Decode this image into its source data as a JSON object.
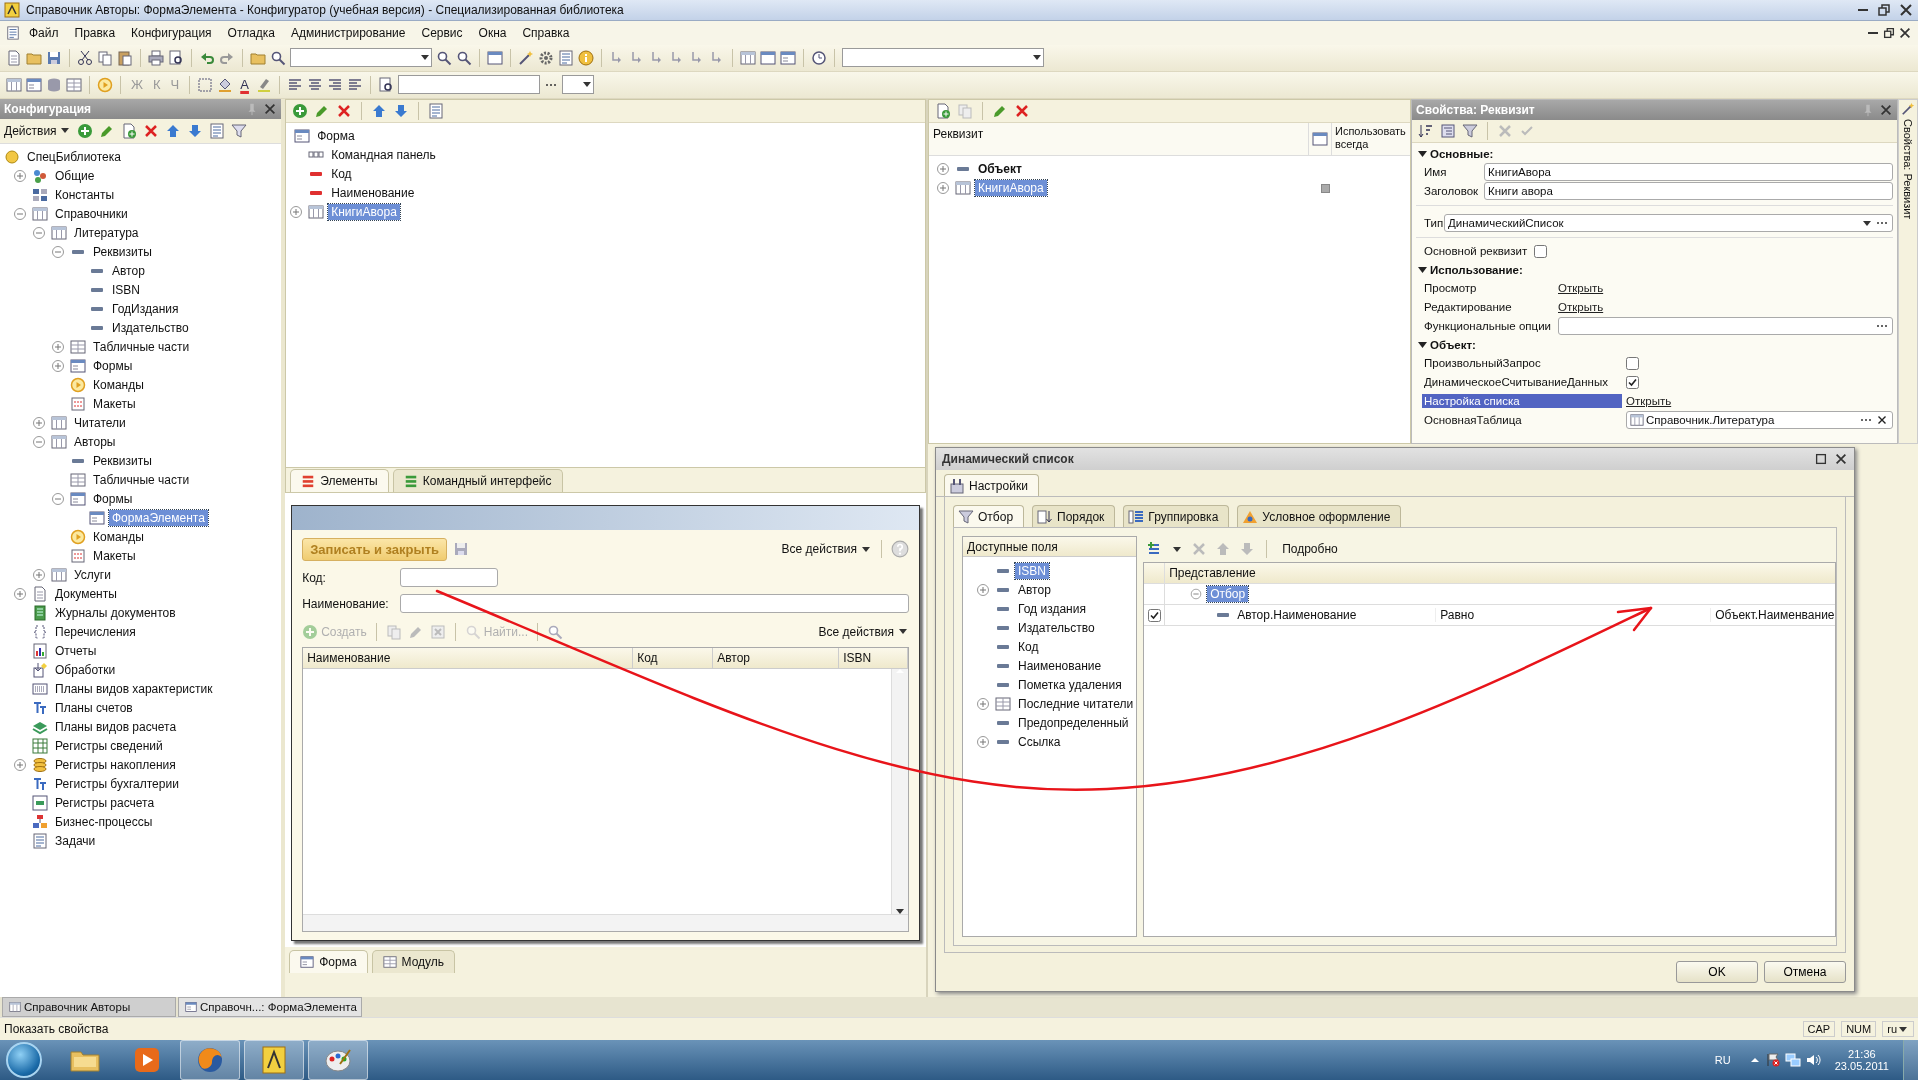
{
  "window": {
    "title": "Справочник Авторы: ФормаЭлемента - Конфигуратор (учебная версия) - Специализированная библиотека"
  },
  "menu": [
    "Файл",
    "Правка",
    "Конфигурация",
    "Отладка",
    "Администрирование",
    "Сервис",
    "Окна",
    "Справка"
  ],
  "format_toolbar": {
    "format_buttons": [
      "Ж",
      "К",
      "Ч"
    ],
    "font_color": "A"
  },
  "config_panel": {
    "title": "Конфигурация",
    "actions": "Действия",
    "tree": [
      {
        "label": "СпецБиблиотека",
        "kind": "root",
        "selected": false,
        "children": [
          {
            "label": "Общие",
            "kind": "common",
            "expanded": false,
            "selected": false
          },
          {
            "label": "Константы",
            "kind": "constants",
            "selected": false
          },
          {
            "label": "Справочники",
            "kind": "catalog",
            "expanded": true,
            "selected": false,
            "children": [
              {
                "label": "Литература",
                "kind": "catalog",
                "expanded": true,
                "selected": false,
                "children": [
                  {
                    "label": "Реквизиты",
                    "kind": "attr",
                    "expanded": true,
                    "selected": false,
                    "children": [
                      {
                        "label": "Автор",
                        "kind": "attr",
                        "selected": false
                      },
                      {
                        "label": "ISBN",
                        "kind": "attr",
                        "selected": false
                      },
                      {
                        "label": "ГодИздания",
                        "kind": "attr",
                        "selected": false
                      },
                      {
                        "label": "Издательство",
                        "kind": "attr",
                        "selected": false
                      }
                    ]
                  },
                  {
                    "label": "Табличные части",
                    "kind": "tabular",
                    "expanded": false,
                    "selected": false
                  },
                  {
                    "label": "Формы",
                    "kind": "form",
                    "expanded": false,
                    "selected": false
                  },
                  {
                    "label": "Команды",
                    "kind": "commands",
                    "selected": false
                  },
                  {
                    "label": "Макеты",
                    "kind": "layouts",
                    "selected": false
                  }
                ]
              },
              {
                "label": "Читатели",
                "kind": "catalog",
                "expanded": false,
                "selected": false
              },
              {
                "label": "Авторы",
                "kind": "catalog",
                "expanded": true,
                "selected": false,
                "children": [
                  {
                    "label": "Реквизиты",
                    "kind": "attr",
                    "selected": false
                  },
                  {
                    "label": "Табличные части",
                    "kind": "tabular",
                    "selected": false
                  },
                  {
                    "label": "Формы",
                    "kind": "form",
                    "expanded": true,
                    "selected": false,
                    "children": [
                      {
                        "label": "ФормаЭлемента",
                        "kind": "form",
                        "selected": true
                      }
                    ]
                  },
                  {
                    "label": "Команды",
                    "kind": "commands",
                    "selected": false
                  },
                  {
                    "label": "Макеты",
                    "kind": "layouts",
                    "selected": false
                  }
                ]
              },
              {
                "label": "Услуги",
                "kind": "catalog",
                "expanded": false,
                "selected": false
              }
            ]
          },
          {
            "label": "Документы",
            "kind": "documents",
            "expanded": false,
            "selected": false
          },
          {
            "label": "Журналы документов",
            "kind": "journals",
            "selected": false
          },
          {
            "label": "Перечисления",
            "kind": "enums",
            "selected": false
          },
          {
            "label": "Отчеты",
            "kind": "reports",
            "selected": false
          },
          {
            "label": "Обработки",
            "kind": "processing",
            "selected": false
          },
          {
            "label": "Планы видов характеристик",
            "kind": "chartchar",
            "selected": false
          },
          {
            "label": "Планы счетов",
            "kind": "accounts",
            "selected": false
          },
          {
            "label": "Планы видов расчета",
            "kind": "calc",
            "selected": false
          },
          {
            "label": "Регистры сведений",
            "kind": "inforeg",
            "selected": false
          },
          {
            "label": "Регистры накопления",
            "kind": "accumreg",
            "expanded": false,
            "selected": false
          },
          {
            "label": "Регистры бухгалтерии",
            "kind": "accounts",
            "selected": false
          },
          {
            "label": "Регистры расчета",
            "kind": "calcreg",
            "selected": false
          },
          {
            "label": "Бизнес-процессы",
            "kind": "bp",
            "selected": false
          },
          {
            "label": "Задачи",
            "kind": "tasks",
            "selected": false
          }
        ]
      }
    ]
  },
  "form_editor": {
    "elements": [
      {
        "label": "Форма",
        "kind": "form",
        "selected": false,
        "children": [
          {
            "label": "Командная панель",
            "kind": "panel",
            "selected": false
          },
          {
            "label": "Код",
            "kind": "input",
            "selected": false
          },
          {
            "label": "Наименование",
            "kind": "input",
            "selected": false
          },
          {
            "label": "КнигиАвора",
            "kind": "catalog",
            "expanded": false,
            "selected": true
          }
        ]
      }
    ],
    "tabs": [
      {
        "label": "Элементы",
        "selected": true
      },
      {
        "label": "Командный интерфейс",
        "selected": false
      }
    ],
    "preview": {
      "save_button": "Записать и закрыть",
      "all_actions": "Все действия",
      "fields": [
        {
          "label": "Код:",
          "kind": "short"
        },
        {
          "label": "Наименование:",
          "kind": "long"
        }
      ],
      "table_buttons": [
        {
          "label": "Создать",
          "disabled": true
        },
        {
          "label": "Найти...",
          "disabled": true
        }
      ],
      "table_all_actions": "Все действия",
      "columns": [
        "Наименование",
        "Код",
        "Автор",
        "ISBN"
      ]
    },
    "bottom_tabs": [
      {
        "label": "Форма",
        "selected": true
      },
      {
        "label": "Модуль",
        "selected": false
      }
    ]
  },
  "attributes_panel": {
    "columns": [
      "Реквизит",
      "Использовать всегда"
    ],
    "rows": [
      {
        "label": "Объект",
        "kind": "object",
        "expanded": false,
        "selected": false
      },
      {
        "label": "КнигиАвора",
        "kind": "catalog",
        "expanded": false,
        "selected": true,
        "use_always": false
      }
    ]
  },
  "properties": {
    "title": "Свойства: Реквизит",
    "side_tab": "Свойства: Реквизит",
    "sections": [
      {
        "title": "Основные:",
        "expanded": true,
        "rows": [
          {
            "kind": "text",
            "label": "Имя",
            "value": "КнигиАвора",
            "selected": false
          },
          {
            "kind": "text",
            "label": "Заголовок",
            "value": "Книги авора",
            "selected": false
          },
          {
            "kind": "combo",
            "label": "Тип",
            "value": "ДинамическийСписок",
            "selected": false
          },
          {
            "kind": "checkbox",
            "label": "Основной реквизит",
            "checked": false,
            "selected": false
          }
        ]
      },
      {
        "title": "Использование:",
        "expanded": true,
        "rows": [
          {
            "kind": "link",
            "label": "Просмотр",
            "value": "Открыть",
            "selected": false
          },
          {
            "kind": "link",
            "label": "Редактирование",
            "value": "Открыть",
            "selected": false
          },
          {
            "kind": "choice",
            "label": "Функциональные опции",
            "selected": false
          }
        ]
      },
      {
        "title": "Объект:",
        "expanded": true,
        "rows": [
          {
            "kind": "checkbox",
            "label": "ПроизвольныйЗапрос",
            "checked": false,
            "selected": false
          },
          {
            "kind": "checkbox",
            "label": "ДинамическоеСчитываниеДанных",
            "checked": true,
            "selected": false
          },
          {
            "kind": "link",
            "label": "Настройка списка",
            "value": "Открыть",
            "selected": true
          },
          {
            "kind": "ref",
            "label": "ОсновнаяТаблица",
            "value": "Справочник.Литература",
            "selected": false
          }
        ]
      }
    ]
  },
  "dialog": {
    "title": "Динамический список",
    "tabs": [
      {
        "label": "Настройки",
        "selected": true
      }
    ],
    "subtabs": [
      {
        "label": "Отбор",
        "kind": "filter",
        "selected": true
      },
      {
        "label": "Порядок",
        "kind": "order",
        "selected": false
      },
      {
        "label": "Группировка",
        "kind": "group",
        "selected": false
      },
      {
        "label": "Условное оформление",
        "kind": "appearance",
        "selected": false
      }
    ],
    "fields_header": "Доступные поля",
    "fields": [
      {
        "label": "ISBN",
        "kind": "attr",
        "selected": true
      },
      {
        "label": "Автор",
        "kind": "attr",
        "expanded": false,
        "selected": false
      },
      {
        "label": "Год издания",
        "kind": "attr",
        "selected": false
      },
      {
        "label": "Издательство",
        "kind": "attr",
        "selected": false
      },
      {
        "label": "Код",
        "kind": "attr",
        "selected": false
      },
      {
        "label": "Наименование",
        "kind": "attr",
        "selected": false
      },
      {
        "label": "Пометка удаления",
        "kind": "attr",
        "selected": false
      },
      {
        "label": "Последние читатели",
        "kind": "tabular",
        "expanded": false,
        "selected": false
      },
      {
        "label": "Предопределенный",
        "kind": "attr",
        "selected": false
      },
      {
        "label": "Ссылка",
        "kind": "attr",
        "expanded": false,
        "selected": false
      }
    ],
    "details": "Подробно",
    "filter_header": "Представление",
    "filter_group": {
      "label": "Отбор",
      "expanded": true,
      "selected": true
    },
    "filter_rows": [
      {
        "checked": true,
        "field": "Автор.Наименование",
        "comparison": "Равно",
        "value": "Объект.Наименвание",
        "selected": false
      }
    ],
    "buttons": [
      "OK",
      "Отмена"
    ]
  },
  "window_tabs": [
    {
      "label": "Справочник Авторы",
      "selected": false
    },
    {
      "label": "Справочн...: ФормаЭлемента",
      "selected": true
    }
  ],
  "status_bar": {
    "text": "Показать свойства",
    "indicators": [
      "CAP",
      "NUM",
      "ru"
    ]
  },
  "taskbar": {
    "apps": [
      {
        "kind": "folder",
        "running": false
      },
      {
        "kind": "media",
        "running": false
      },
      {
        "kind": "browser",
        "running": true
      },
      {
        "kind": "app",
        "running": true
      },
      {
        "kind": "paint",
        "running": true
      }
    ],
    "language": "RU",
    "time": "21:36",
    "date": "23.05.2011"
  }
}
